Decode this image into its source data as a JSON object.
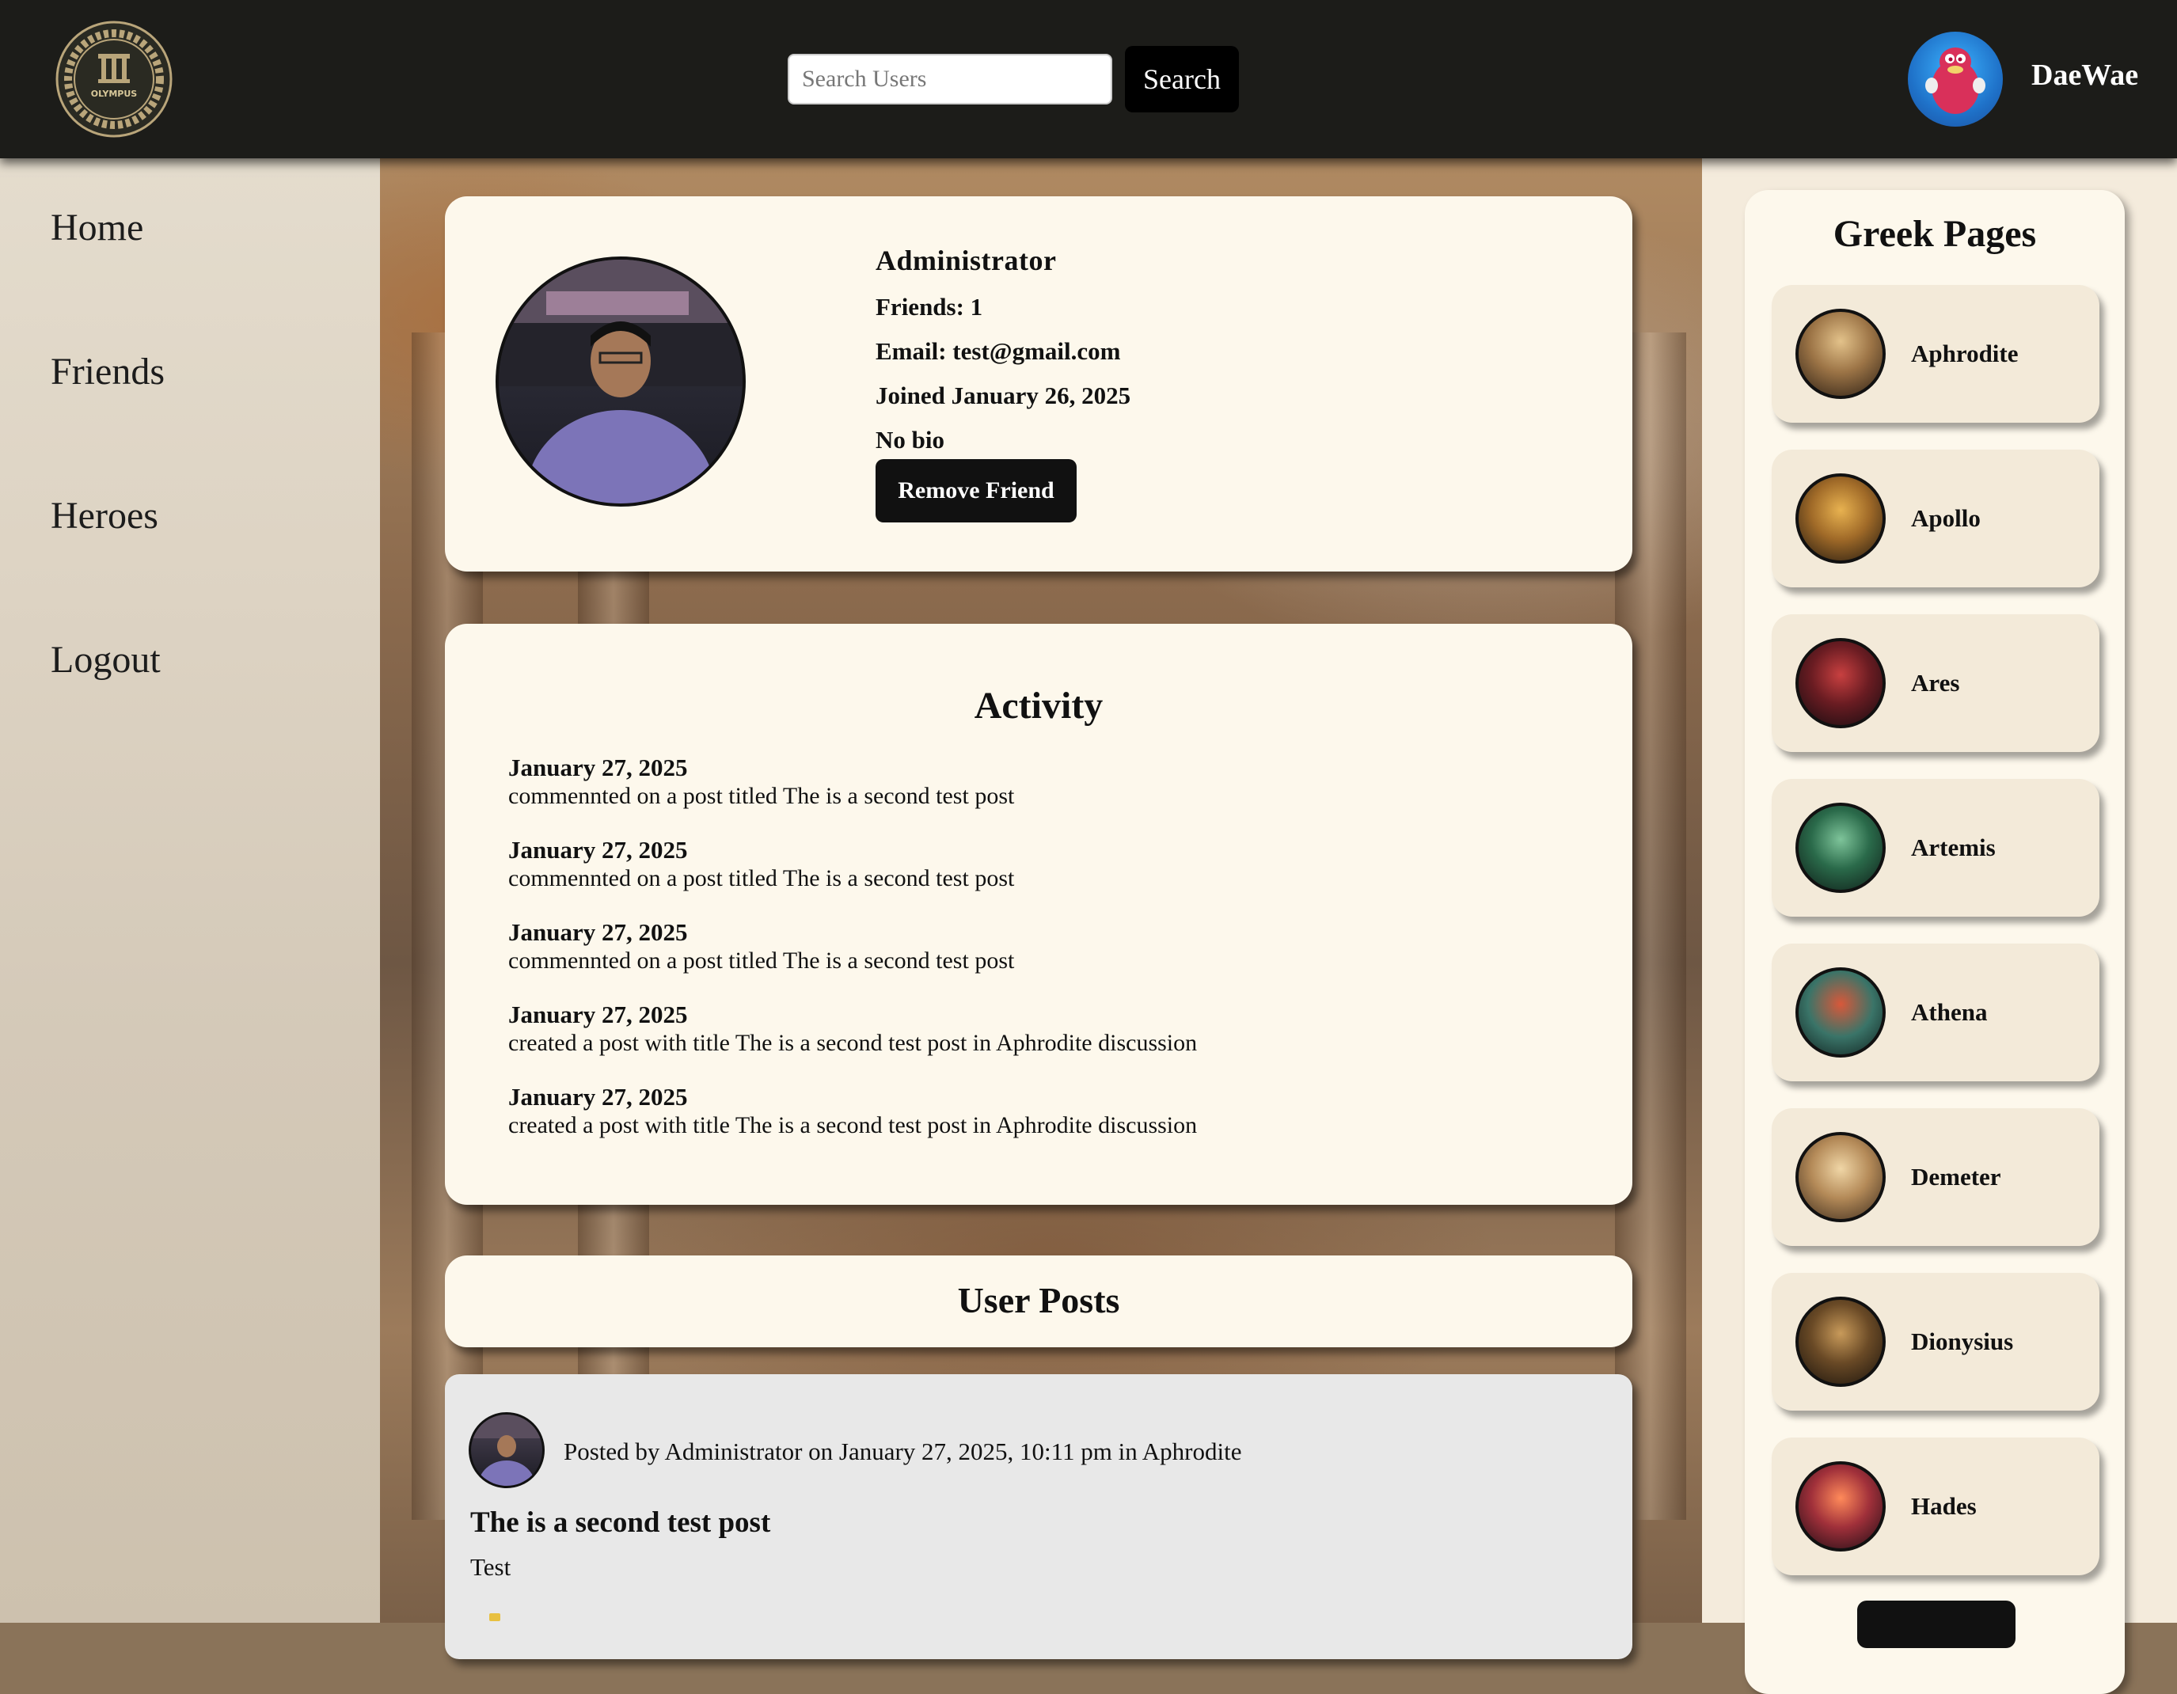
{
  "header": {
    "logo_text": "OLYMPUS",
    "search_placeholder": "Search Users",
    "search_button": "Search",
    "username": "DaeWae"
  },
  "sidebar": {
    "items": [
      {
        "label": "Home"
      },
      {
        "label": "Friends"
      },
      {
        "label": "Heroes"
      },
      {
        "label": "Logout"
      }
    ]
  },
  "profile": {
    "name": "Administrator",
    "friends": "Friends: 1",
    "email": "Email: test@gmail.com",
    "joined": "Joined January 26, 2025",
    "bio": "No bio",
    "remove_button": "Remove Friend"
  },
  "activity": {
    "title": "Activity",
    "items": [
      {
        "date": "January 27, 2025",
        "text": "commennted on a post titled The is a second test post"
      },
      {
        "date": "January 27, 2025",
        "text": "commennted on a post titled The is a second test post"
      },
      {
        "date": "January 27, 2025",
        "text": "commennted on a post titled The is a second test post"
      },
      {
        "date": "January 27, 2025",
        "text": "created a post with title The is a second test post in Aphrodite discussion"
      },
      {
        "date": "January 27, 2025",
        "text": "created a post with title The is a second test post in Aphrodite discussion"
      }
    ]
  },
  "user_posts": {
    "title": "User Posts",
    "posts": [
      {
        "meta": "Posted by Administrator on January 27, 2025, 10:11 pm in Aphrodite",
        "title": "The is a second test post",
        "body": "Test"
      }
    ]
  },
  "greek_pages": {
    "title": "Greek Pages",
    "gods": [
      {
        "name": "Aphrodite"
      },
      {
        "name": "Apollo"
      },
      {
        "name": "Ares"
      },
      {
        "name": "Artemis"
      },
      {
        "name": "Athena"
      },
      {
        "name": "Demeter"
      },
      {
        "name": "Dionysius"
      },
      {
        "name": "Hades"
      }
    ]
  },
  "colors": {
    "header_bg": "#1c1c19",
    "card_bg": "#fdf8ec",
    "button_bg": "#111111",
    "post_bg": "#e8e8e8"
  }
}
